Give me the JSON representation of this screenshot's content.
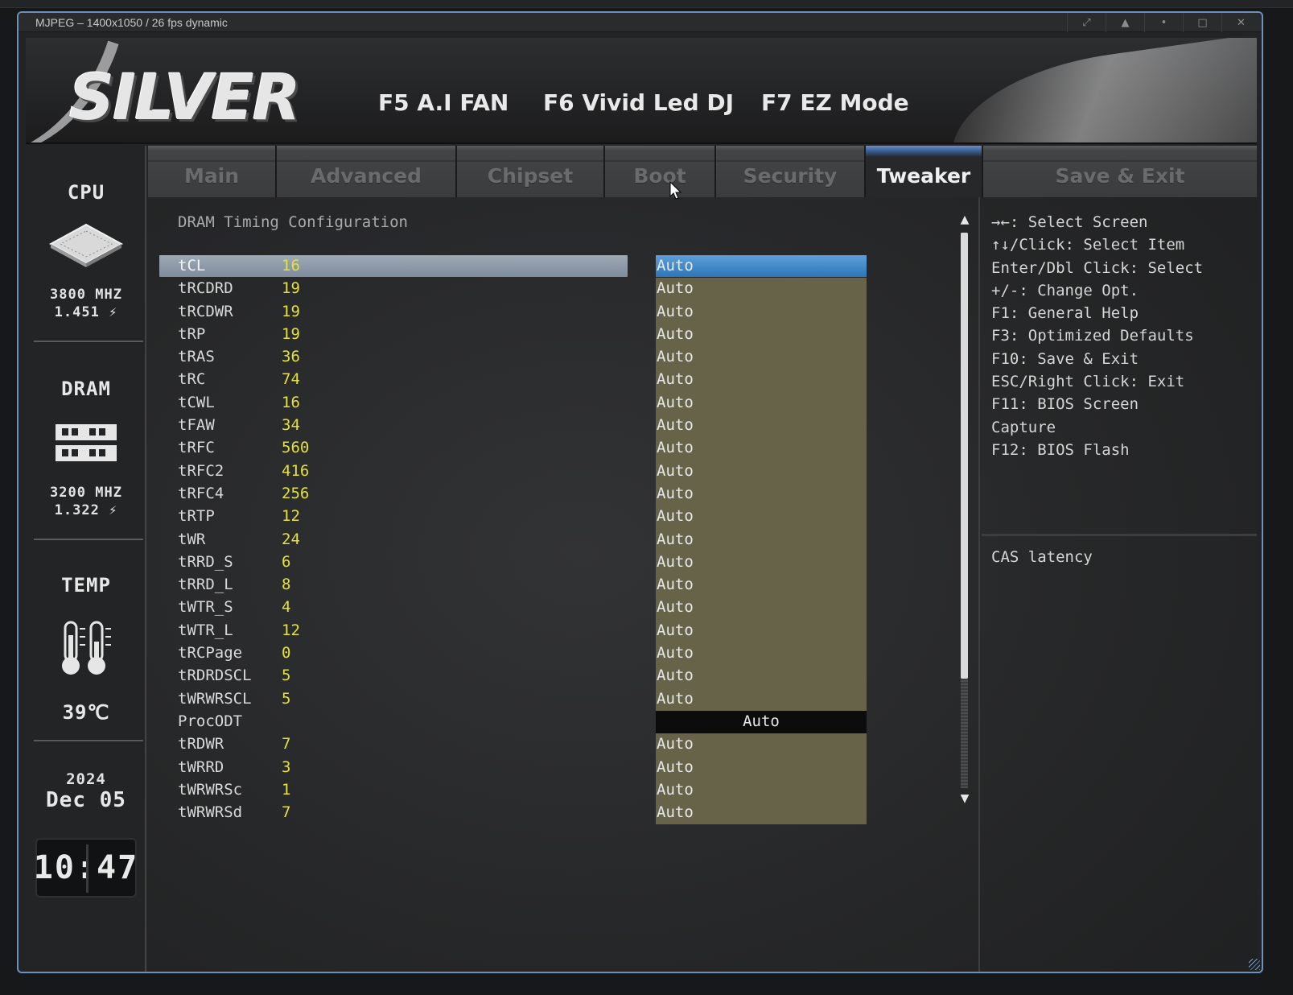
{
  "window": {
    "title": "MJPEG – 1400x1050 / 26 fps dynamic",
    "buttons": [
      "⤢",
      "▲",
      "•",
      "□",
      "✕"
    ]
  },
  "banner": {
    "brand": "SILVER",
    "fkeys": [
      "F5 A.I FAN",
      "F6 Vivid Led DJ",
      "F7 EZ Mode"
    ]
  },
  "sidebar": {
    "cpu": {
      "label": "CPU",
      "freq": "3800 MHZ",
      "volt": "1.451 ⚡"
    },
    "dram": {
      "label": "DRAM",
      "freq": "3200 MHZ",
      "volt": "1.322 ⚡"
    },
    "temp": {
      "label": "TEMP",
      "value": "39℃"
    },
    "date": {
      "year": "2024",
      "day": "Dec 05"
    },
    "clock": "10:47"
  },
  "tabs": [
    "Main",
    "Advanced",
    "Chipset",
    "Boot",
    "Security",
    "Tweaker",
    "Save & Exit"
  ],
  "active_tab": "Tweaker",
  "main": {
    "section_title": "DRAM Timing Configuration",
    "rows": [
      {
        "name": "tCL",
        "value": "16",
        "option": "Auto"
      },
      {
        "name": "tRCDRD",
        "value": "19",
        "option": "Auto"
      },
      {
        "name": "tRCDWR",
        "value": "19",
        "option": "Auto"
      },
      {
        "name": "tRP",
        "value": "19",
        "option": "Auto"
      },
      {
        "name": "tRAS",
        "value": "36",
        "option": "Auto"
      },
      {
        "name": "tRC",
        "value": "74",
        "option": "Auto"
      },
      {
        "name": "tCWL",
        "value": "16",
        "option": "Auto"
      },
      {
        "name": "tFAW",
        "value": "34",
        "option": "Auto"
      },
      {
        "name": "tRFC",
        "value": "560",
        "option": "Auto"
      },
      {
        "name": "tRFC2",
        "value": "416",
        "option": "Auto"
      },
      {
        "name": "tRFC4",
        "value": "256",
        "option": "Auto"
      },
      {
        "name": "tRTP",
        "value": "12",
        "option": "Auto"
      },
      {
        "name": "tWR",
        "value": "24",
        "option": "Auto"
      },
      {
        "name": "tRRD_S",
        "value": "6",
        "option": "Auto"
      },
      {
        "name": "tRRD_L",
        "value": "8",
        "option": "Auto"
      },
      {
        "name": "tWTR_S",
        "value": "4",
        "option": "Auto"
      },
      {
        "name": "tWTR_L",
        "value": "12",
        "option": "Auto"
      },
      {
        "name": "tRCPage",
        "value": "0",
        "option": "Auto"
      },
      {
        "name": "tRDRDSCL",
        "value": "5",
        "option": "Auto"
      },
      {
        "name": "tWRWRSCL",
        "value": "5",
        "option": "Auto"
      },
      {
        "name": "ProcODT",
        "value": "",
        "option": "Auto"
      },
      {
        "name": "tRDWR",
        "value": "7",
        "option": "Auto"
      },
      {
        "name": "tWRRD",
        "value": "3",
        "option": "Auto"
      },
      {
        "name": "tWRWRSc",
        "value": "1",
        "option": "Auto"
      },
      {
        "name": "tWRWRSd",
        "value": "7",
        "option": "Auto"
      }
    ]
  },
  "help": {
    "keys": [
      "→←: Select Screen",
      "↑↓/Click: Select Item",
      "Enter/Dbl Click: Select",
      "+/-: Change Opt.",
      "F1: General Help",
      "F3: Optimized Defaults",
      "F10: Save & Exit",
      "ESC/Right Click: Exit",
      "F11: BIOS Screen",
      "Capture",
      "F12: BIOS Flash"
    ],
    "description": "CAS latency"
  },
  "colors": {
    "accent": "#2f76b8",
    "value_yellow": "#e3e13a",
    "option_bg": "#666349",
    "window_border": "#6f8fbd"
  }
}
